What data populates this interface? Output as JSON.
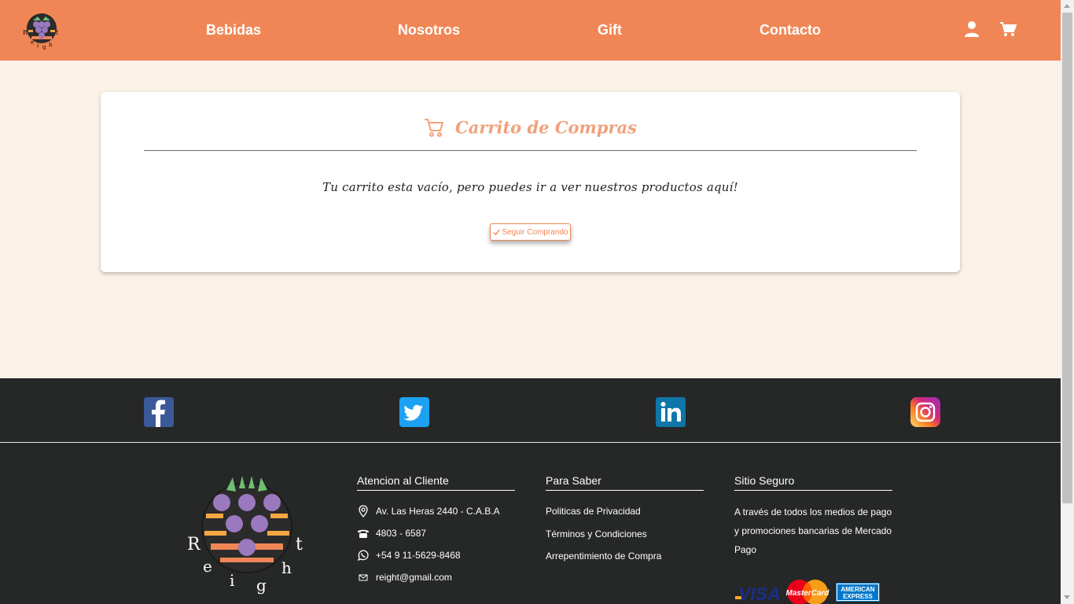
{
  "header": {
    "nav": [
      "Bebidas",
      "Nosotros",
      "Gift",
      "Contacto"
    ],
    "logo_letters": [
      "R",
      "e",
      "i",
      "g",
      "h",
      "t"
    ]
  },
  "cart": {
    "title": "Carrito de Compras",
    "empty_message": "Tu carrito esta vacío, pero puedes ir a ver nuestros productos aquí!",
    "button_label": "Seguir Comprando"
  },
  "social": [
    "facebook",
    "twitter",
    "linkedin",
    "instagram"
  ],
  "footer": {
    "atencion": {
      "title": "Atencion al Cliente",
      "address": "Av. Las Heras 2440 - C.A.B.A",
      "phone": "4803 - 6587",
      "whatsapp": "+54 9 11-5629-8468",
      "email": "reight@gmail.com"
    },
    "saber": {
      "title": "Para Saber",
      "links": [
        "Politicas de Privacidad",
        "Términos y Condiciones",
        "Arrepentimiento de Compra"
      ]
    },
    "seguro": {
      "title": "Sitio Seguro",
      "text": "A través de todos los medios de pago y promociones bancarias de Mercado Pago",
      "cards": {
        "visa": "VISA",
        "mastercard": "MasterCard",
        "amex_line1": "AMERICAN",
        "amex_line2": "EXPRESS"
      }
    }
  },
  "colors": {
    "brand": "#f08656",
    "background": "#fbf2e7",
    "footer": "#262727",
    "title": "#f0a17a"
  }
}
